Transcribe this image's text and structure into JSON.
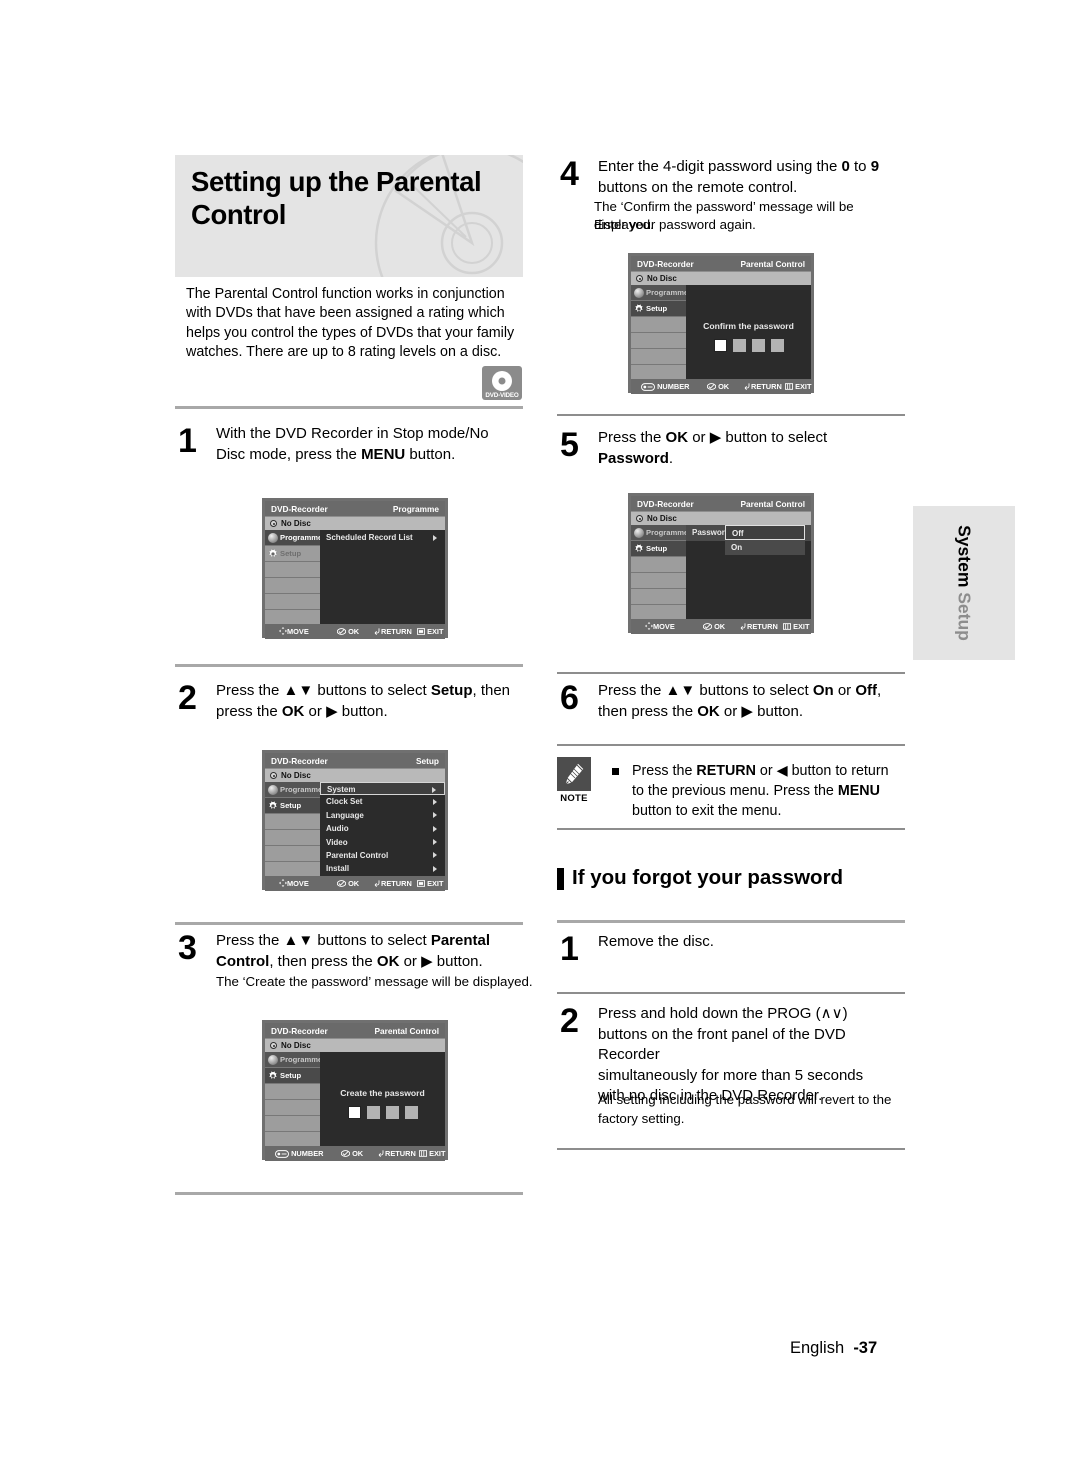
{
  "header": {
    "title_line1": "Setting up the Parental",
    "title_line2": "Control",
    "intro": "The Parental Control function works in conjunction with DVDs that have been assigned a rating which helps you control the types of DVDs that your family watches. There are up to 8 rating levels on a disc.",
    "disc_badge": "DVD-VIDEO"
  },
  "side_tab": {
    "part1": "System",
    "part2": "Setup"
  },
  "footer": {
    "language": "English",
    "page": "-37"
  },
  "osd_common": {
    "device": "DVD-Recorder",
    "disc_status": "No Disc",
    "sidebar": {
      "programme": "Programme",
      "setup": "Setup"
    },
    "keys": {
      "move": "MOVE",
      "ok": "OK",
      "return": "RETURN",
      "exit": "EXIT",
      "number": "NUMBER"
    }
  },
  "steps": [
    {
      "num": "1",
      "line1_a": "With the DVD Recorder in Stop mode/No",
      "line2_a": "Disc mode, press the ",
      "line2_b": "MENU",
      "line2_c": " button.",
      "screen": {
        "title": "Programme",
        "menu_item": "Scheduled Record List"
      }
    },
    {
      "num": "2",
      "line1_a": "Press the ",
      "line1_arrows": "▲▼",
      "line1_b": " buttons to select ",
      "line1_c": "Setup",
      "line1_d": ", then",
      "line2_a": "press the ",
      "line2_b": "OK",
      "line2_c": " or ",
      "line2_arrow": "▶",
      "line2_d": " button.",
      "screen": {
        "title": "Setup",
        "items": [
          "System",
          "Clock Set",
          "Language",
          "Audio",
          "Video",
          "Parental Control",
          "Install"
        ],
        "selected_index": 0
      }
    },
    {
      "num": "3",
      "line1_a": "Press the ",
      "line1_arrows": "▲▼",
      "line1_b": " buttons to select ",
      "line1_c": "Parental",
      "line2_a": "Control",
      "line2_b": ", then press the ",
      "line2_c": "OK",
      "line2_d": " or ",
      "line2_arrow": "▶",
      "line2_e": " button.",
      "sub": "The ‘Create the password’ message will be displayed.",
      "screen": {
        "title": "Parental Control",
        "message": "Create the password"
      }
    },
    {
      "num": "4",
      "line1_a": "Enter the 4-digit password using the ",
      "line1_b": "0",
      "line1_c": " to ",
      "line1_d": "9",
      "line2_a": "buttons on the remote control.",
      "sub1": "The ‘Confirm the password’ message will be displayed.",
      "sub2": "Enter your password again.",
      "screen": {
        "title": "Parental Control",
        "message": "Confirm the password"
      }
    },
    {
      "num": "5",
      "line1_a": "Press the ",
      "line1_b": "OK",
      "line1_c": " or ",
      "line1_arrow": "▶",
      "line1_d": " button to select",
      "line2_a": "Password",
      "line2_b": ".",
      "screen": {
        "title": "Parental Control",
        "row_label": "Password",
        "options": [
          "Off",
          "On"
        ],
        "selected_index": 0
      }
    },
    {
      "num": "6",
      "line1_a": "Press the ",
      "line1_arrows": "▲▼",
      "line1_b": " buttons to select ",
      "line1_c": "On",
      "line1_d": " or ",
      "line1_e": "Off",
      "line1_f": ",",
      "line2_a": "then press the ",
      "line2_b": "OK",
      "line2_c": " or ",
      "line2_arrow": "▶",
      "line2_d": " button."
    }
  ],
  "note": {
    "label": "NOTE",
    "line1_a": "Press the ",
    "line1_b": "RETURN",
    "line1_c": " or ",
    "line1_arrow": "◀",
    "line1_d": " button to return",
    "line2_a": "to the previous menu. Press the ",
    "line2_b": "MENU",
    "line3_a": "button to exit the menu."
  },
  "forgot_section": {
    "heading": "If you forgot your password",
    "steps": [
      {
        "num": "1",
        "text": "Remove the disc."
      },
      {
        "num": "2",
        "line1_a": "Press and hold down the PROG (",
        "line1_arrows": "∧∨",
        "line1_b": ")",
        "line2": "buttons on the front panel of the DVD Recorder",
        "line3": "simultaneously for more than 5 seconds",
        "line4": "with no disc in the DVD Recorder.",
        "sub1": "All setting including the password will revert to the",
        "sub2": "factory setting."
      }
    ]
  }
}
